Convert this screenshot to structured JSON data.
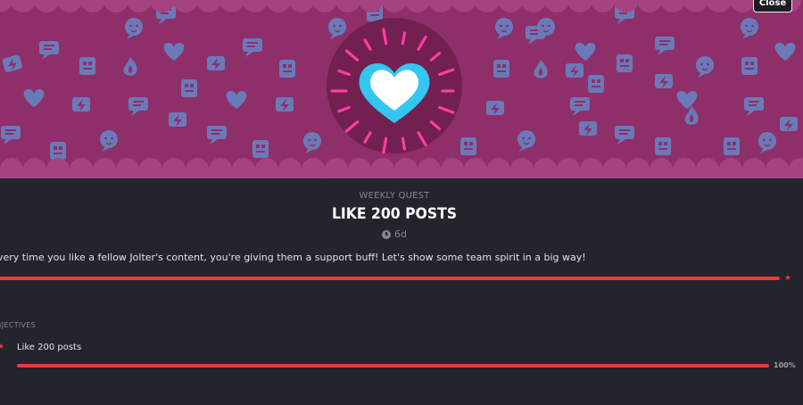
{
  "banner": {
    "colors": {
      "background": "#8e2f6a",
      "icon": "#6a7ab8",
      "scallop": "#a5437f",
      "badge": "#72204f",
      "heart_outline": "#33c6f0",
      "rays": "#ff3da6"
    },
    "pattern_icons": [
      "chat-bubble-icon",
      "lightning-icon",
      "robot-face-icon",
      "heart-icon",
      "dual-lightning-icon",
      "flame-icon",
      "tablet-icon"
    ],
    "badge_icon": "glowing-heart-icon"
  },
  "close_label": "Close",
  "quest": {
    "kind": "WEEKLY QUEST",
    "title": "LIKE 200 POSTS",
    "time_left": "6d",
    "description": "very time you like a fellow Jolter's content, you're giving them a support buff! Let's show some team spirit in a big way!",
    "progress": 1.0
  },
  "objectives": {
    "heading": "BJECTIVES",
    "items": [
      {
        "text": "Like 200 posts",
        "progress": 1.0,
        "percent_label": "100%"
      }
    ]
  },
  "accent": "#e63b3d"
}
